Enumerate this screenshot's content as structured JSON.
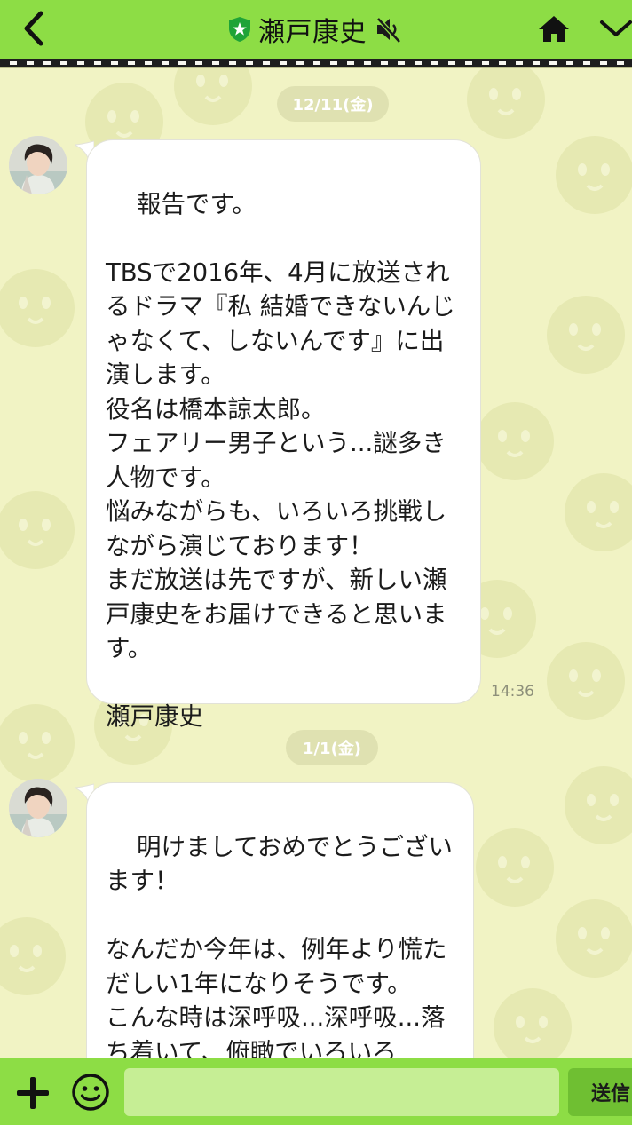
{
  "header": {
    "back_icon": "chevron-left-icon",
    "official_icon": "shield-star-icon",
    "title": "瀬戸康史",
    "mute_icon": "speaker-muted-icon",
    "home_icon": "home-icon",
    "menu_icon": "chevron-down-icon"
  },
  "messages": [
    {
      "date": "12/11(金)",
      "text": "報告です。\n\nTBSで2016年、4月に放送されるドラマ『私 結婚できないんじゃなくて、しないんです』に出演します。\n役名は橋本諒太郎。\nフェアリー男子という...謎多き人物です。\n悩みながらも、いろいろ挑戦しながら演じております！\nまだ放送は先ですが、新しい瀬戸康史をお届けできると思います。\n\n瀬戸康史",
      "time": "14:36"
    },
    {
      "date": "1/1(金)",
      "text": "明けましておめでとうございます！\n\nなんだか今年は、例年より慌ただしい1年になりそうです。\nこんな時は深呼吸...深呼吸...落ち着いて、俯瞰でいろいろ",
      "time": ""
    }
  ],
  "input": {
    "plus_icon": "plus-icon",
    "emoji_icon": "smiley-icon",
    "placeholder": "",
    "value": "",
    "send_label": "送信"
  },
  "colors": {
    "header_green": "#8ddd45",
    "chat_background": "#f1f3c4",
    "bubble": "#ffffff",
    "date_pill": "#dfe1b1",
    "input_field": "#c6ee95",
    "send_button": "#6fbf32"
  }
}
